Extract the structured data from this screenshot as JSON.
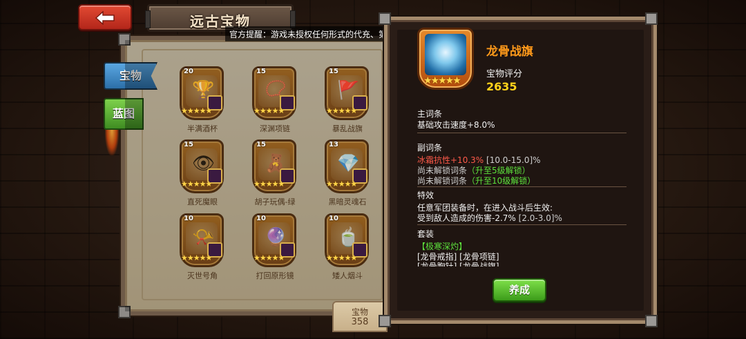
{
  "header": {
    "title": "远古宝物",
    "back_icon": "left-arrow-icon"
  },
  "notice": "官方提醒：游戏未授权任何形式的代充、第三方辅助软件及第三方账户交易等",
  "tabs": [
    {
      "label": "宝物",
      "active": true
    },
    {
      "label": "蓝图",
      "active": false
    }
  ],
  "items": [
    {
      "level": "20",
      "name": "半满酒杯",
      "stars": 5,
      "icon": "goblet-icon"
    },
    {
      "level": "15",
      "name": "深渊项链",
      "stars": 5,
      "icon": "necklace-icon"
    },
    {
      "level": "15",
      "name": "暴乱战旗",
      "stars": 5,
      "icon": "banner-icon"
    },
    {
      "level": "15",
      "name": "直死魔眼",
      "stars": 5,
      "icon": "eye-icon"
    },
    {
      "level": "15",
      "name": "胡子玩偶-绿",
      "stars": 5,
      "icon": "doll-icon"
    },
    {
      "level": "13",
      "name": "黑暗灵魂石",
      "stars": 5,
      "icon": "crystal-icon"
    },
    {
      "level": "10",
      "name": "灭世号角",
      "stars": 5,
      "icon": "horn-icon"
    },
    {
      "level": "10",
      "name": "打回原形镜",
      "stars": 5,
      "icon": "mirror-icon"
    },
    {
      "level": "10",
      "name": "矮人烟斗",
      "stars": 5,
      "icon": "pipe-icon"
    }
  ],
  "bottom_tab": {
    "label": "宝物",
    "value": "358"
  },
  "detail": {
    "name": "龙骨战旗",
    "icon": "dragon-bone-banner-icon",
    "stars": 5,
    "score_label": "宝物评分",
    "score": "2635",
    "main_header": "主词条",
    "main_stat": "基础攻击速度+8.0%",
    "sub_header": "副词条",
    "sub_stat_value": "冰霜抗性+10.3%",
    "sub_stat_range": "[10.0-15.0]%",
    "locked_1_prefix": "尚未解锁词条",
    "locked_1_hint": "（升至5级解锁）",
    "locked_2_prefix": "尚未解锁词条",
    "locked_2_hint": "（升至10级解锁）",
    "effect_header": "特效",
    "effect_line1": "任意军团装备时，在进入战斗后生效:",
    "effect_line2_value": "受到敌人造成的伤害-2.7%",
    "effect_line2_range": "[2.0-3.0]%",
    "set_header": "套装",
    "set_name": "【极寒深灼】",
    "set_items_1": "[龙骨戒指] [龙骨项链]",
    "set_items_2": "[龙骨胸针] [龙骨战旗]",
    "train_button": "养成"
  },
  "colors": {
    "item_name": "#ff9a1a",
    "score": "#ffd21a",
    "red_stat": "#ff5a4a",
    "green_hint": "#5ce13c",
    "train_button": "#5fbf2c"
  }
}
